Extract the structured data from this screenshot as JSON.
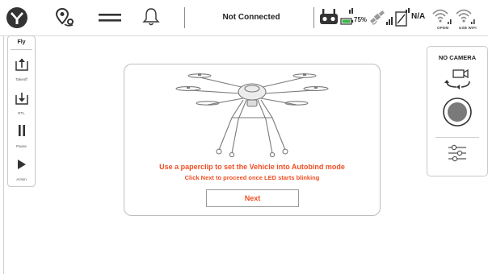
{
  "topbar": {
    "connection_status": "Not Connected",
    "battery_percent": "75%",
    "rc_signal": "N/A",
    "opdm_label": "OPDM",
    "usb_wifi_label": "USB WIFI"
  },
  "fly_toolbar": {
    "title": "Fly",
    "takeoff_label": "Takeoff",
    "rtl_label": "RTL",
    "pause_label": "Pause",
    "action_label": "Action"
  },
  "dialog": {
    "instruction": "Use a paperclip to set the Vehicle into Autobind mode",
    "hint": "Click Next to proceed once LED starts blinking",
    "next_label": "Next"
  },
  "camera_panel": {
    "title": "NO CAMERA"
  },
  "colors": {
    "accent": "#f04e23",
    "battery": "#3cb44b",
    "icon": "#333333"
  }
}
